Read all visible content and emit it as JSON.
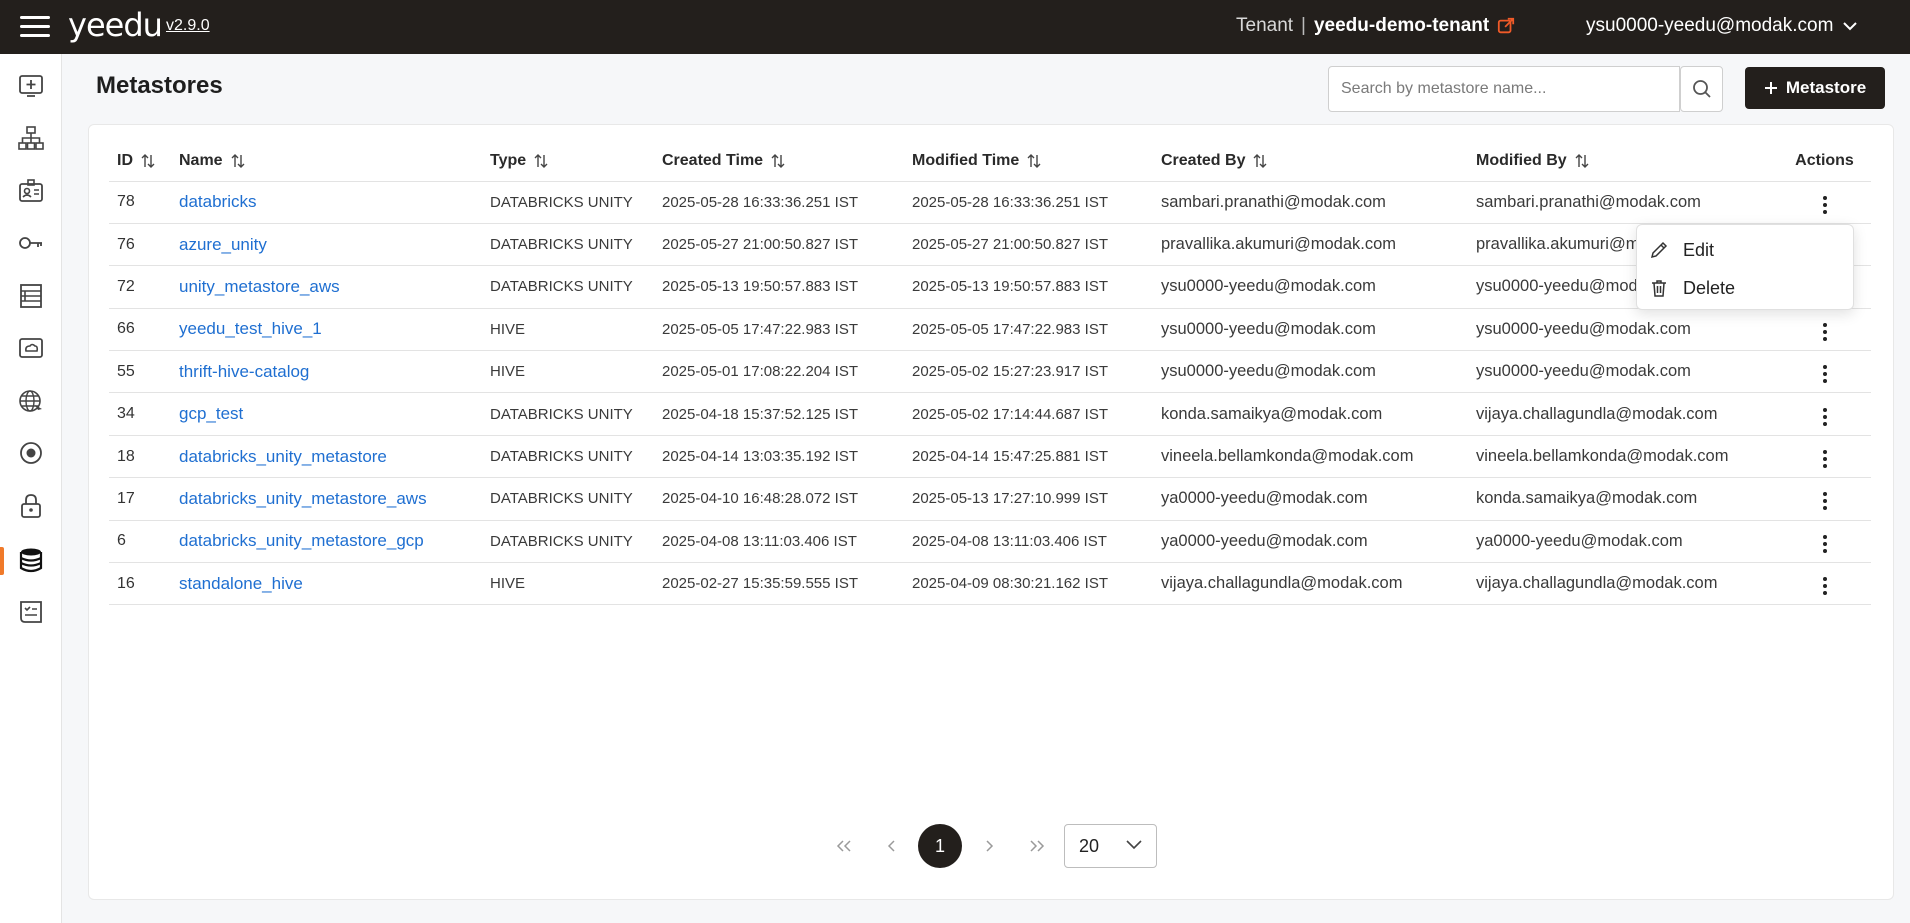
{
  "app": {
    "logo": "yeedu",
    "version": "v2.9.0",
    "tenant_label": "Tenant",
    "tenant_name": "yeedu-demo-tenant",
    "user_email": "ysu0000-yeedu@modak.com"
  },
  "page": {
    "title": "Metastores",
    "search_placeholder": "Search by metastore name...",
    "add_button_label": "Metastore"
  },
  "sidebar": {
    "items": [
      {
        "icon": "workspace-icon"
      },
      {
        "icon": "cluster-icon"
      },
      {
        "icon": "profile-card-icon"
      },
      {
        "icon": "key-icon"
      },
      {
        "icon": "storage-rack-icon"
      },
      {
        "icon": "cloud-drive-icon"
      },
      {
        "icon": "network-icon"
      },
      {
        "icon": "target-icon"
      },
      {
        "icon": "lock-icon"
      },
      {
        "icon": "database-icon",
        "active": true
      },
      {
        "icon": "billing-icon"
      }
    ],
    "accent_color": "#f07a2a"
  },
  "table": {
    "columns": [
      "ID",
      "Name",
      "Type",
      "Created Time",
      "Modified Time",
      "Created By",
      "Modified By",
      "Actions"
    ],
    "rows": [
      {
        "id": "78",
        "name": "databricks",
        "type": "DATABRICKS UNITY",
        "created": "2025-05-28 16:33:36.251 IST",
        "modified": "2025-05-28 16:33:36.251 IST",
        "created_by": "sambari.pranathi@modak.com",
        "modified_by": "sambari.pranathi@modak.com"
      },
      {
        "id": "76",
        "name": "azure_unity",
        "type": "DATABRICKS UNITY",
        "created": "2025-05-27 21:00:50.827 IST",
        "modified": "2025-05-27 21:00:50.827 IST",
        "created_by": "pravallika.akumuri@modak.com",
        "modified_by": "pravallika.akumuri@modak.com"
      },
      {
        "id": "72",
        "name": "unity_metastore_aws",
        "type": "DATABRICKS UNITY",
        "created": "2025-05-13 19:50:57.883 IST",
        "modified": "2025-05-13 19:50:57.883 IST",
        "created_by": "ysu0000-yeedu@modak.com",
        "modified_by": "ysu0000-yeedu@modak.com"
      },
      {
        "id": "66",
        "name": "yeedu_test_hive_1",
        "type": "HIVE",
        "created": "2025-05-05 17:47:22.983 IST",
        "modified": "2025-05-05 17:47:22.983 IST",
        "created_by": "ysu0000-yeedu@modak.com",
        "modified_by": "ysu0000-yeedu@modak.com"
      },
      {
        "id": "55",
        "name": "thrift-hive-catalog",
        "type": "HIVE",
        "created": "2025-05-01 17:08:22.204 IST",
        "modified": "2025-05-02 15:27:23.917 IST",
        "created_by": "ysu0000-yeedu@modak.com",
        "modified_by": "ysu0000-yeedu@modak.com"
      },
      {
        "id": "34",
        "name": "gcp_test",
        "type": "DATABRICKS UNITY",
        "created": "2025-04-18 15:37:52.125 IST",
        "modified": "2025-05-02 17:14:44.687 IST",
        "created_by": "konda.samaikya@modak.com",
        "modified_by": "vijaya.challagundla@modak.com"
      },
      {
        "id": "18",
        "name": "databricks_unity_metastore",
        "type": "DATABRICKS UNITY",
        "created": "2025-04-14 13:03:35.192 IST",
        "modified": "2025-04-14 15:47:25.881 IST",
        "created_by": "vineela.bellamkonda@modak.com",
        "modified_by": "vineela.bellamkonda@modak.com"
      },
      {
        "id": "17",
        "name": "databricks_unity_metastore_aws",
        "type": "DATABRICKS UNITY",
        "created": "2025-04-10 16:48:28.072 IST",
        "modified": "2025-05-13 17:27:10.999 IST",
        "created_by": "ya0000-yeedu@modak.com",
        "modified_by": "konda.samaikya@modak.com"
      },
      {
        "id": "6",
        "name": "databricks_unity_metastore_gcp",
        "type": "DATABRICKS UNITY",
        "created": "2025-04-08 13:11:03.406 IST",
        "modified": "2025-04-08 13:11:03.406 IST",
        "created_by": "ya0000-yeedu@modak.com",
        "modified_by": "ya0000-yeedu@modak.com"
      },
      {
        "id": "16",
        "name": "standalone_hive",
        "type": "HIVE",
        "created": "2025-02-27 15:35:59.555 IST",
        "modified": "2025-04-09 08:30:21.162 IST",
        "created_by": "vijaya.challagundla@modak.com",
        "modified_by": "vijaya.challagundla@modak.com"
      }
    ]
  },
  "action_menu": {
    "edit_label": "Edit",
    "delete_label": "Delete"
  },
  "pagination": {
    "current_page": "1",
    "page_size": "20"
  },
  "colors": {
    "topbar": "#231f1c",
    "link": "#1f6fd1",
    "external_link_icon": "#f05a28"
  }
}
